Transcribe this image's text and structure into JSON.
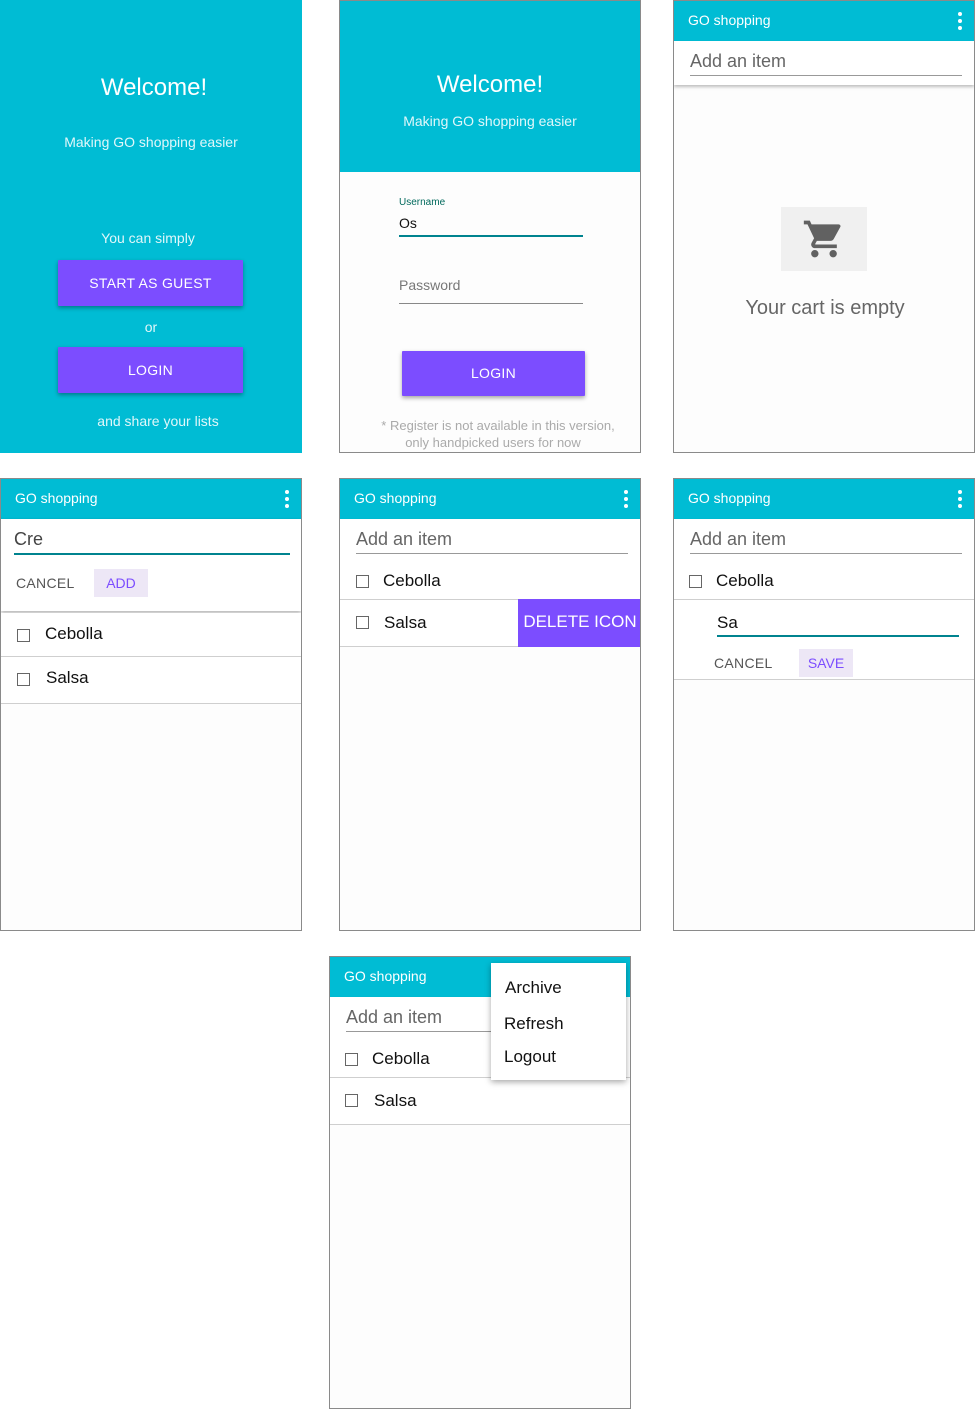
{
  "colors": {
    "teal": "#00bcd4",
    "accent": "#7c4dff",
    "accent_light": "#ede7f6"
  },
  "welcome": {
    "title": "Welcome!",
    "subtitle": "Making GO shopping easier",
    "simply": "You can simply",
    "guest_button": "START AS GUEST",
    "or": "or",
    "login_button": "LOGIN",
    "share": "and share your lists"
  },
  "login": {
    "title": "Welcome!",
    "subtitle": "Making GO shopping easier",
    "username_label": "Username",
    "username_value": "Os",
    "password_placeholder": "Password",
    "login_button": "LOGIN",
    "note_line1": "* Register is not available in this version,",
    "note_line2": "only handpicked users for now"
  },
  "app": {
    "title": "GO shopping",
    "menu_icon": "more-vert-icon",
    "add_placeholder": "Add an item"
  },
  "empty": {
    "cart_icon": "cart-icon",
    "message": "Your cart is empty"
  },
  "adding": {
    "input_value": "Cre",
    "cancel": "CANCEL",
    "add": "ADD"
  },
  "items": [
    "Cebolla",
    "Salsa"
  ],
  "swipe": {
    "delete_label": "DELETE ICON"
  },
  "editing": {
    "input_value": "Sa",
    "cancel": "CANCEL",
    "save": "SAVE"
  },
  "menu": {
    "items": [
      "Archive",
      "Refresh",
      "Logout"
    ]
  }
}
